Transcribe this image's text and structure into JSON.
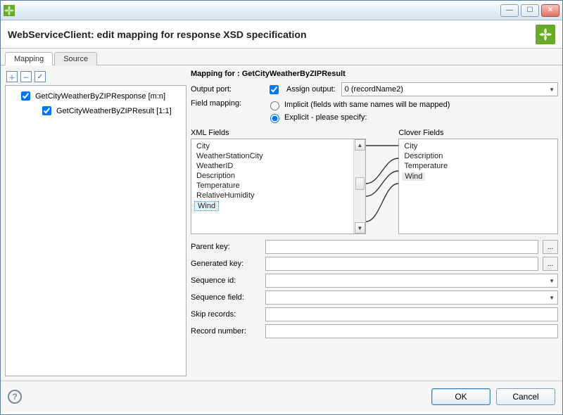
{
  "window": {
    "title": "WebServiceClient: edit mapping for response XSD specification"
  },
  "tabs": [
    {
      "label": "Mapping",
      "active": true
    },
    {
      "label": "Source",
      "active": false
    }
  ],
  "tree": {
    "items": [
      {
        "label": "GetCityWeatherByZIPResponse [m:n]",
        "checked": true,
        "level": 1
      },
      {
        "label": "GetCityWeatherByZIPResult [1:1]",
        "checked": true,
        "level": 2
      }
    ]
  },
  "mapping": {
    "heading": "Mapping for : GetCityWeatherByZIPResult",
    "output_port_label": "Output port:",
    "assign_output_label": "Assign output:",
    "assign_output_checked": true,
    "output_port_value": "0 (recordName2)",
    "field_mapping_label": "Field mapping:",
    "radio_implicit": "Implicit (fields with same names will be mapped)",
    "radio_explicit": "Explicit - please specify:",
    "radio_selected": "explicit",
    "xml_fields_label": "XML Fields",
    "clover_fields_label": "Clover Fields",
    "xml_fields": [
      "City",
      "WeatherStationCity",
      "WeatherID",
      "Description",
      "Temperature",
      "RelativeHumidity",
      "Wind"
    ],
    "xml_selected": "Wind",
    "clover_fields": [
      "City",
      "Description",
      "Temperature",
      "Wind"
    ],
    "clover_selected": "Wind"
  },
  "form": {
    "parent_key_label": "Parent key:",
    "generated_key_label": "Generated key:",
    "sequence_id_label": "Sequence id:",
    "sequence_field_label": "Sequence field:",
    "skip_records_label": "Skip records:",
    "record_number_label": "Record number:",
    "parent_key_value": "",
    "generated_key_value": "",
    "sequence_id_value": "",
    "sequence_field_value": "",
    "skip_records_value": "",
    "record_number_value": ""
  },
  "buttons": {
    "ok": "OK",
    "cancel": "Cancel"
  },
  "icons": {
    "ellipsis": "..."
  }
}
